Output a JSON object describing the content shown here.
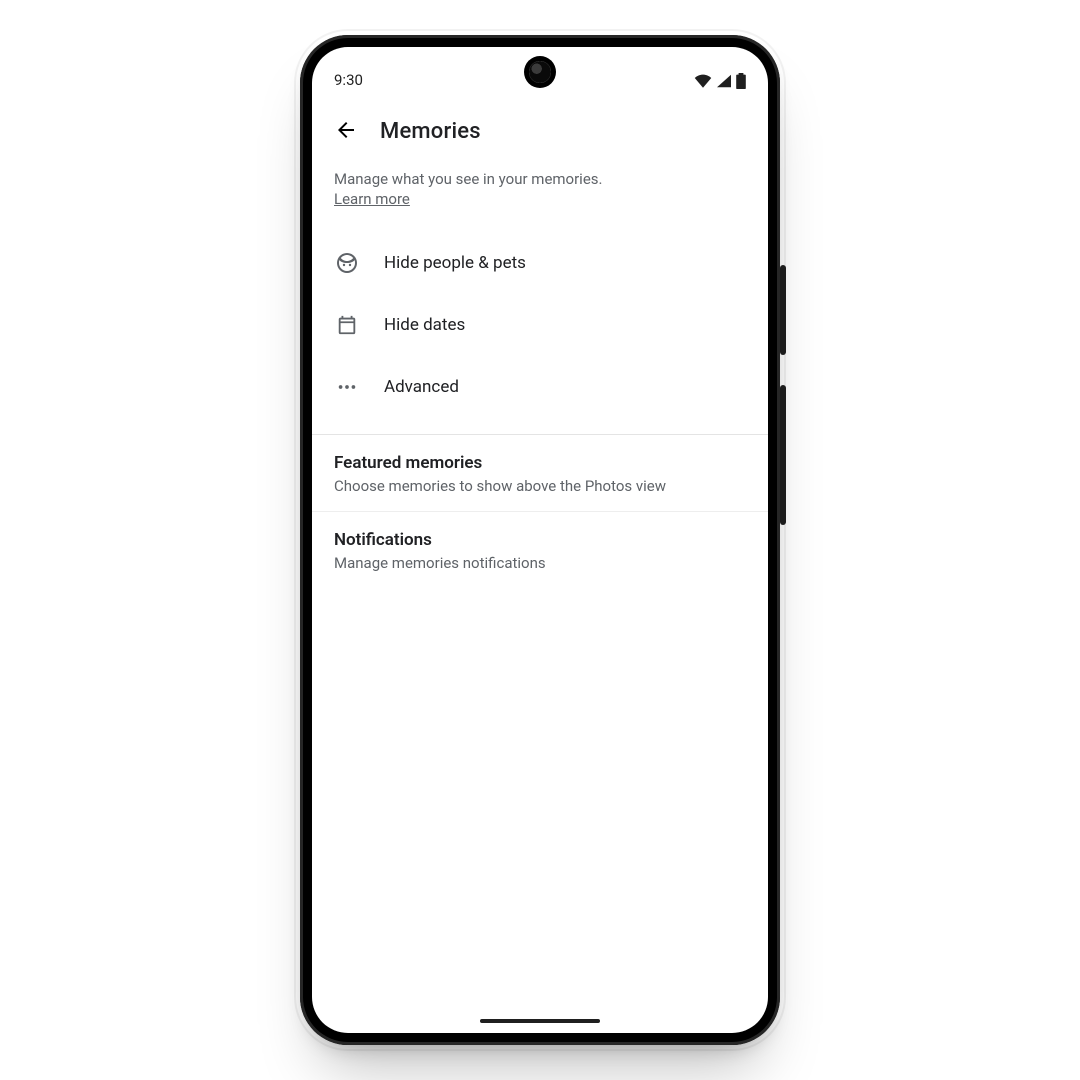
{
  "status": {
    "time": "9:30"
  },
  "appbar": {
    "title": "Memories"
  },
  "intro": {
    "text": "Manage what you see in your memories.",
    "learn_more": "Learn more"
  },
  "menu": {
    "hide_people": "Hide people & pets",
    "hide_dates": "Hide dates",
    "advanced": "Advanced"
  },
  "sections": {
    "featured": {
      "title": "Featured memories",
      "subtitle": "Choose memories to show above the Photos view"
    },
    "notifications": {
      "title": "Notifications",
      "subtitle": "Manage memories notifications"
    }
  }
}
